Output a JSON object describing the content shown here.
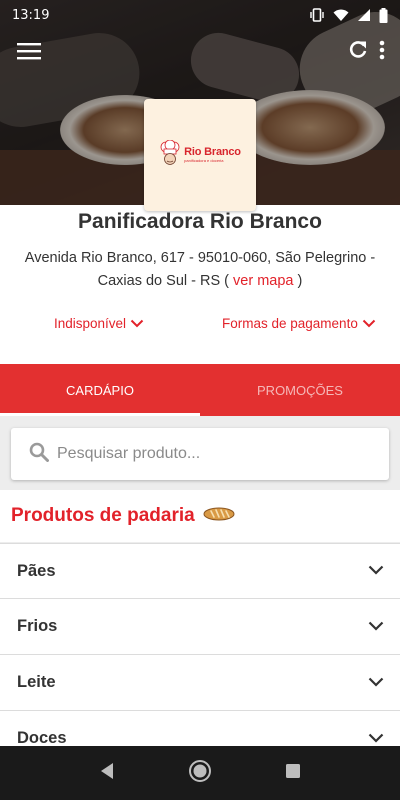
{
  "status_bar": {
    "time": "13:19",
    "icons": [
      "vibrate-icon",
      "wifi-icon",
      "signal-icon",
      "battery-icon"
    ]
  },
  "toolbar": {
    "icons": [
      "menu-icon",
      "refresh-icon",
      "more-vert-icon"
    ]
  },
  "store": {
    "logo_text": "Rio Branco",
    "logo_subtext": "panificadora e doceria",
    "name": "Panificadora Rio Branco",
    "address": "Avenida Rio Branco, 617 - 95010-060, São Pelegrino - Caxias do Sul - RS (",
    "map_link": "ver mapa",
    "address_close": ")",
    "availability": "Indisponível",
    "payment": "Formas de pagamento"
  },
  "tabs": [
    {
      "label": "CARDÁPIO",
      "active": true
    },
    {
      "label": "PROMOÇÕES",
      "active": false
    }
  ],
  "search": {
    "placeholder": "Pesquisar produto..."
  },
  "section": {
    "title": "Produtos de padaria",
    "icon": "bread-icon"
  },
  "categories": [
    {
      "label": "Pães"
    },
    {
      "label": "Frios"
    },
    {
      "label": "Leite"
    },
    {
      "label": "Doces"
    }
  ],
  "navigation": {
    "icons": [
      "back-icon",
      "home-icon",
      "recents-icon"
    ]
  },
  "colors": {
    "accent": "#e2222a",
    "tabbar": "#e33030",
    "navbar": "#1a1a1a"
  }
}
